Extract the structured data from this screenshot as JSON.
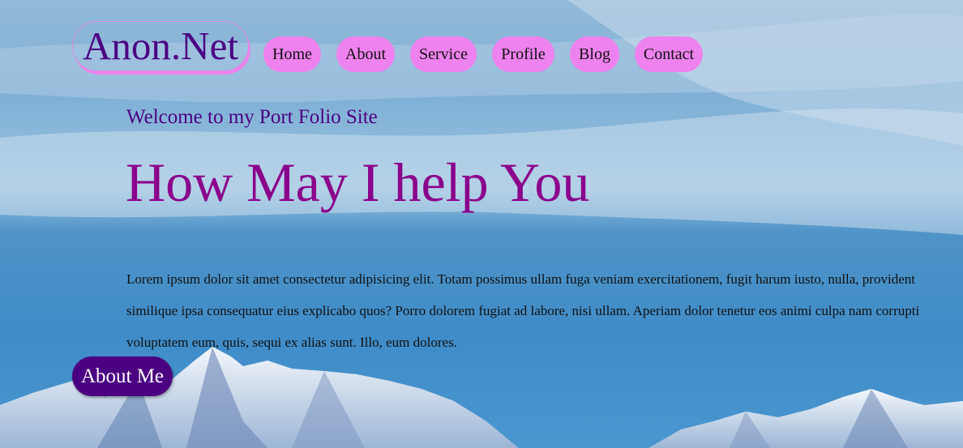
{
  "header": {
    "logo_text": "Anon.Net",
    "nav": [
      {
        "label": "Home"
      },
      {
        "label": "About"
      },
      {
        "label": "Service"
      },
      {
        "label": "Profile"
      },
      {
        "label": "Blog"
      },
      {
        "label": "Contact"
      }
    ]
  },
  "hero": {
    "welcome": "Welcome to my Port Folio Site",
    "headline": "How May I help You",
    "paragraph": "Lorem ipsum dolor sit amet consectetur adipisicing elit. Totam possimus ullam fuga veniam exercitationem, fugit harum iusto, nulla, provident similique ipsa consequatur eius explicabo quos? Porro dolorem fugiat ad labore, nisi ullam. Aperiam dolor tenetur eos animi culpa nam corrupti voluptatem eum, quis, sequi ex alias sunt. Illo, eum dolores.",
    "button_label": "About Me"
  },
  "colors": {
    "accent_pink": "#ee82ee",
    "accent_indigo": "#4b0082",
    "headline_magenta": "#8b008b"
  }
}
